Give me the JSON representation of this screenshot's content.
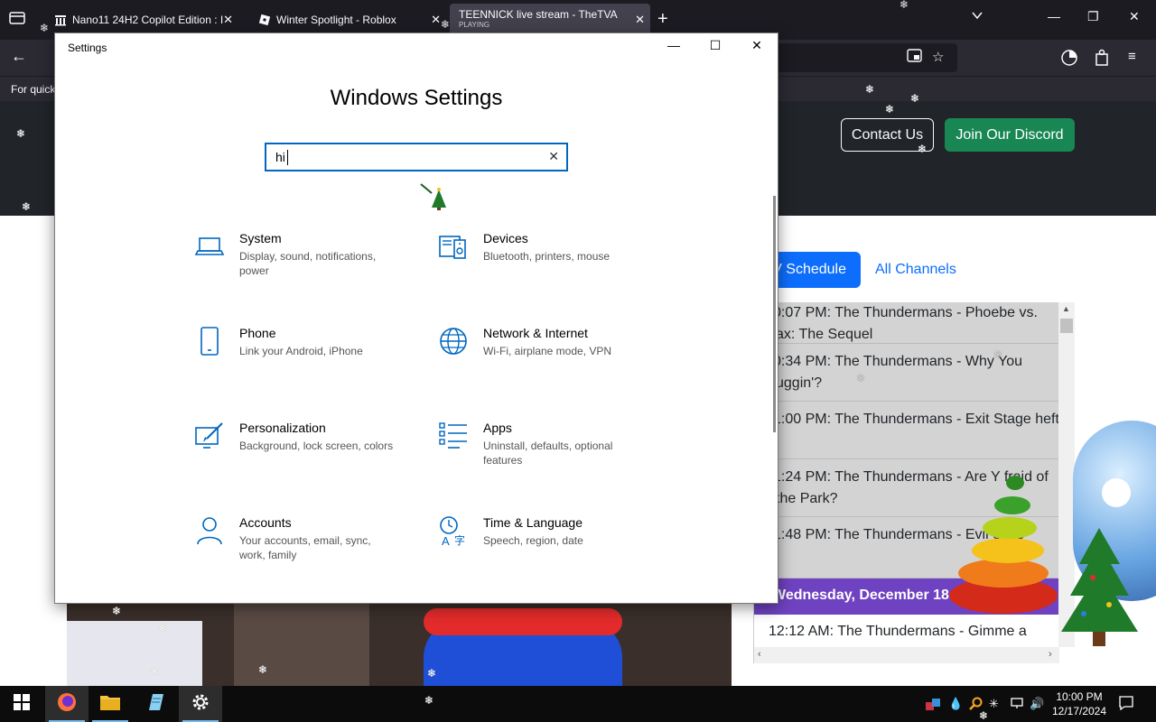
{
  "browser": {
    "tabs": [
      {
        "title": "Nano11 24H2 Copilot Edition : I",
        "active": false
      },
      {
        "title": "Winter Spotlight - Roblox",
        "active": false
      },
      {
        "title": "TEENNICK live stream - TheTVA",
        "subtitle": "PLAYING",
        "active": true
      }
    ],
    "bookmarks_text": "For quick"
  },
  "site": {
    "contact_label": "Contact Us",
    "discord_label": "Join Our Discord",
    "tabs": {
      "schedule": "V Schedule",
      "all_channels": "All Channels"
    },
    "schedule": [
      {
        "text": "0:07 PM: The Thundermans - Phoebe vs. ax: The Sequel"
      },
      {
        "text": "0:34 PM: The Thundermans - Why You uggin'?"
      },
      {
        "text": "1:00 PM: The Thundermans - Exit Stage heft"
      },
      {
        "text": "1:24 PM: The Thundermans - Are Y fraid of the Park?"
      },
      {
        "text": "1:48 PM: The Thundermans - Evil eeps"
      }
    ],
    "day_header": "Wednesday, December 18",
    "next_item": "12:12 AM: The Thundermans - Gimme a"
  },
  "settings": {
    "window_title": "Settings",
    "heading": "Windows Settings",
    "search": {
      "value": "hi"
    },
    "categories": [
      {
        "name": "System",
        "desc": "Display, sound, notifications, power",
        "icon": "laptop-icon"
      },
      {
        "name": "Devices",
        "desc": "Bluetooth, printers, mouse",
        "icon": "keyboard-speaker-icon"
      },
      {
        "name": "Phone",
        "desc": "Link your Android, iPhone",
        "icon": "phone-icon"
      },
      {
        "name": "Network & Internet",
        "desc": "Wi-Fi, airplane mode, VPN",
        "icon": "globe-icon"
      },
      {
        "name": "Personalization",
        "desc": "Background, lock screen, colors",
        "icon": "paint-brush-icon"
      },
      {
        "name": "Apps",
        "desc": "Uninstall, defaults, optional features",
        "icon": "apps-list-icon"
      },
      {
        "name": "Accounts",
        "desc": "Your accounts, email, sync, work, family",
        "icon": "person-icon"
      },
      {
        "name": "Time & Language",
        "desc": "Speech, region, date",
        "icon": "time-language-icon"
      }
    ],
    "accent": "#0067c0"
  },
  "taskbar": {
    "clock_time": "10:00 PM",
    "clock_date": "12/17/2024"
  }
}
